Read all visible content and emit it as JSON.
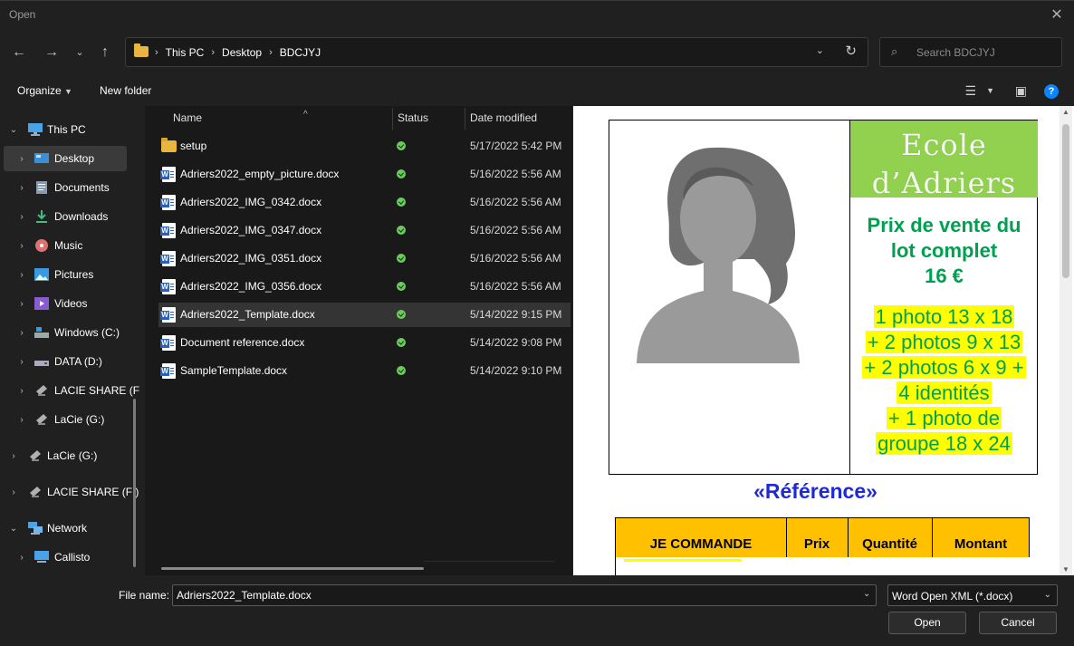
{
  "window": {
    "title": "Open"
  },
  "nav": {
    "breadcrumb": [
      "This PC",
      "Desktop",
      "BDCJYJ"
    ],
    "search_placeholder": "Search BDCJYJ"
  },
  "toolbar": {
    "organize_label": "Organize",
    "new_folder_label": "New folder"
  },
  "sidebar": {
    "items": [
      {
        "label": "This PC",
        "icon": "computer-icon",
        "expanded": true
      },
      {
        "label": "Desktop",
        "icon": "desktop-icon",
        "selected": true
      },
      {
        "label": "Documents",
        "icon": "documents-icon"
      },
      {
        "label": "Downloads",
        "icon": "downloads-icon"
      },
      {
        "label": "Music",
        "icon": "music-icon"
      },
      {
        "label": "Pictures",
        "icon": "pictures-icon"
      },
      {
        "label": "Videos",
        "icon": "videos-icon"
      },
      {
        "label": "Windows (C:)",
        "icon": "drive-icon"
      },
      {
        "label": "DATA (D:)",
        "icon": "drive-icon"
      },
      {
        "label": "LACIE SHARE (F",
        "icon": "network-drive-icon"
      },
      {
        "label": "LaCie (G:)",
        "icon": "network-drive-icon"
      },
      {
        "label": "LaCie (G:)",
        "icon": "network-drive-icon"
      },
      {
        "label": "LACIE SHARE (F:)",
        "icon": "network-drive-icon"
      },
      {
        "label": "Network",
        "icon": "network-icon",
        "expanded": true
      },
      {
        "label": "Callisto",
        "icon": "computer-icon"
      }
    ]
  },
  "filelist": {
    "columns": [
      "Name",
      "Status",
      "Date modified"
    ],
    "files": [
      {
        "name": "setup",
        "type": "folder",
        "date": "5/17/2022 5:42 PM"
      },
      {
        "name": "Adriers2022_empty_picture.docx",
        "type": "docx",
        "date": "5/16/2022 5:56 AM"
      },
      {
        "name": "Adriers2022_IMG_0342.docx",
        "type": "docx",
        "date": "5/16/2022 5:56 AM"
      },
      {
        "name": "Adriers2022_IMG_0347.docx",
        "type": "docx",
        "date": "5/16/2022 5:56 AM"
      },
      {
        "name": "Adriers2022_IMG_0351.docx",
        "type": "docx",
        "date": "5/16/2022 5:56 AM"
      },
      {
        "name": "Adriers2022_IMG_0356.docx",
        "type": "docx",
        "date": "5/16/2022 5:56 AM"
      },
      {
        "name": "Adriers2022_Template.docx",
        "type": "docx",
        "date": "5/14/2022 9:15 PM",
        "selected": true
      },
      {
        "name": "Document reference.docx",
        "type": "docx",
        "date": "5/14/2022 9:08 PM"
      },
      {
        "name": "SampleTemplate.docx",
        "type": "docx",
        "date": "5/14/2022 9:10 PM"
      }
    ]
  },
  "preview": {
    "school_line1": "Ecole",
    "school_line2": "d’Adriers",
    "price_line1": "Prix de vente du",
    "price_line2": "lot complet",
    "price_line3": "16 €",
    "items": [
      "1 photo 13 x 18",
      "+ 2 photos 9 x 13",
      "+ 2 photos 6 x 9 +",
      "4 identités",
      "+ 1 photo de",
      "groupe 18 x 24"
    ],
    "reference": "«Référence»",
    "order_columns": [
      "JE COMMANDE",
      "Prix",
      "Quantité",
      "Montant"
    ]
  },
  "bottom": {
    "filename_label": "File name:",
    "filename_value": "Adriers2022_Template.docx",
    "filetype": "Word Open XML (*.docx)",
    "open_label": "Open",
    "cancel_label": "Cancel"
  },
  "colors": {
    "accent": "#0a84ff",
    "school_bg": "#92d050",
    "price_text": "#00a050",
    "highlight": "#ffff00",
    "reference": "#1c2bd6",
    "order_bg": "#ffc000"
  }
}
